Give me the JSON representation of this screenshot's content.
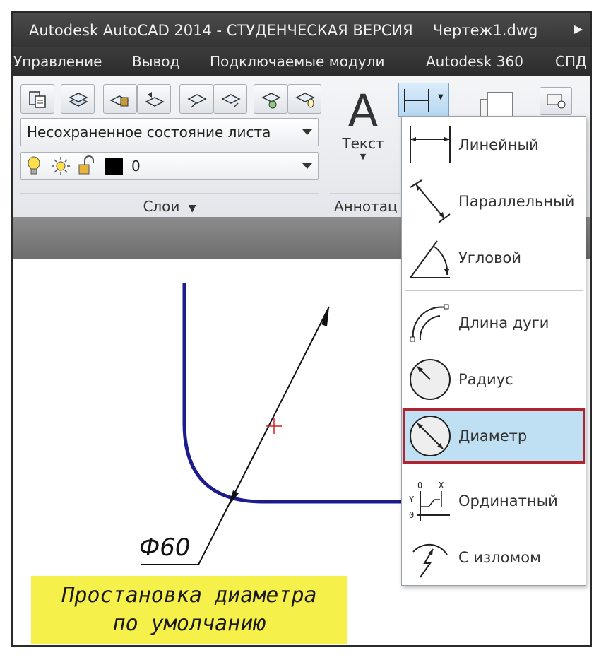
{
  "window": {
    "title": "Autodesk AutoCAD 2014 - СТУДЕНЧЕСКАЯ ВЕРСИЯ",
    "filename": "Чертеж1.dwg"
  },
  "menu": [
    "Управление",
    "Вывод",
    "Подключаемые модули",
    "Autodesk 360",
    "СПД"
  ],
  "ribbon": {
    "layer_state_combo": "Несохраненное состояние листа",
    "layer_combo_value": "0",
    "layers_panel_label": "Слои",
    "text_tool_label": "Текст",
    "text_tool_glyph": "A",
    "annotation_panel_label": "Аннотац"
  },
  "dimension_menu": {
    "items": [
      {
        "label": "Линейный",
        "icon": "linear-dimension-icon"
      },
      {
        "label": "Параллельный",
        "icon": "aligned-dimension-icon"
      },
      {
        "label": "Угловой",
        "icon": "angular-dimension-icon"
      },
      {
        "label": "Длина дуги",
        "icon": "arc-length-icon"
      },
      {
        "label": "Радиус",
        "icon": "radius-icon"
      },
      {
        "label": "Диаметр",
        "icon": "diameter-icon",
        "selected": true
      },
      {
        "label": "Ординатный",
        "icon": "ordinate-icon"
      },
      {
        "label": "С изломом",
        "icon": "jogged-icon"
      }
    ]
  },
  "drawing": {
    "dimension_text": "Ф60",
    "curve_color": "#1c1c8c",
    "center_mark_color": "#cc2222"
  },
  "caption": {
    "line1": "Простановка диаметра",
    "line2": "по умолчанию",
    "background": "#f6f04a"
  },
  "colors": {
    "selection_border": "#b1232d",
    "selection_fill": "#bfe0f3"
  }
}
